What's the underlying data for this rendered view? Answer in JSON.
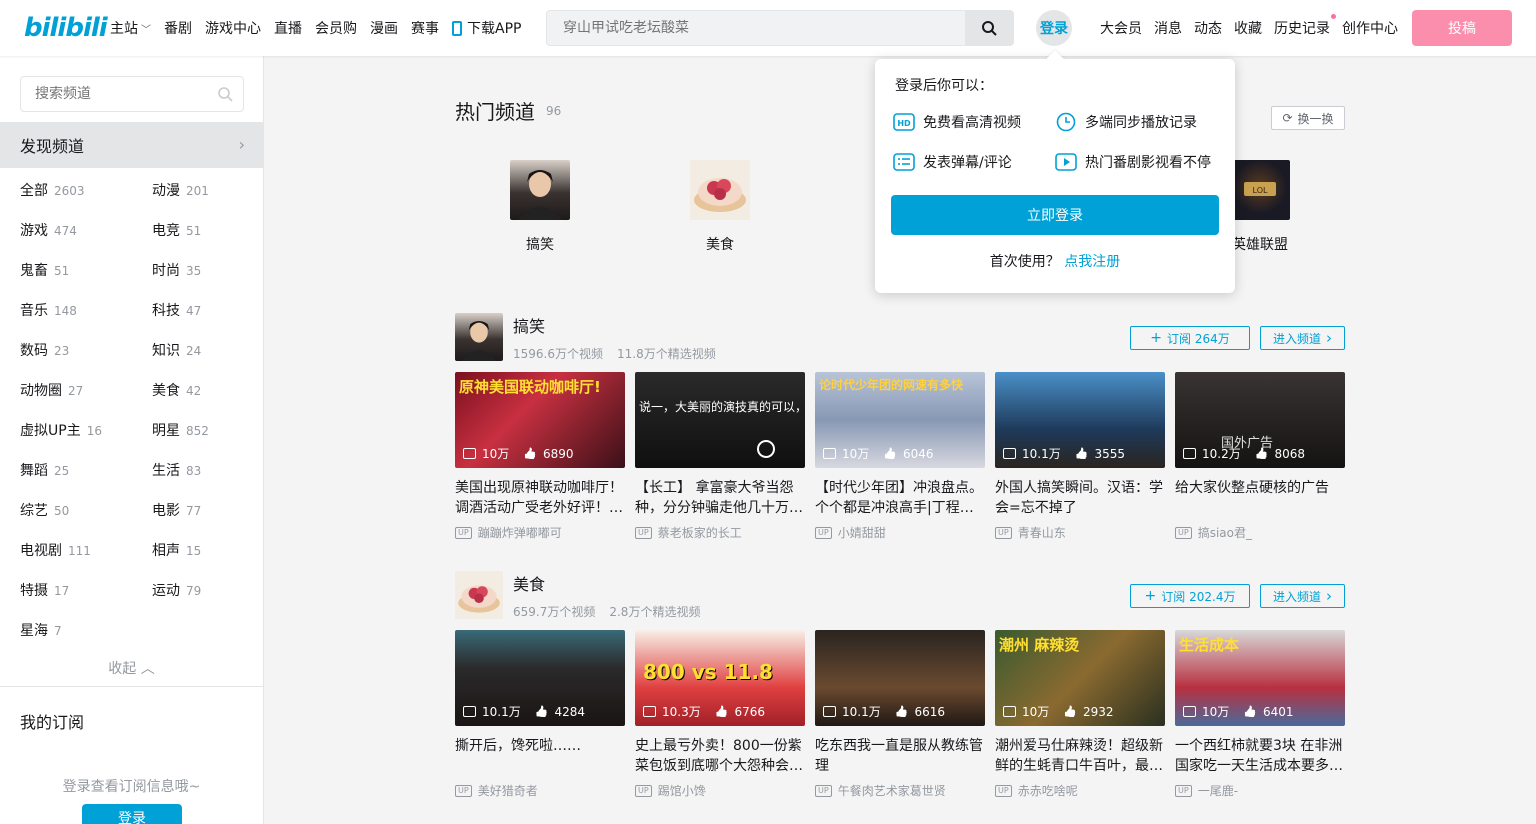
{
  "header": {
    "logo": "bilibili",
    "nav": [
      "主站",
      "番剧",
      "游戏中心",
      "直播",
      "会员购",
      "漫画",
      "赛事",
      "下载APP"
    ],
    "search_placeholder": "穿山甲试吃老坛酸菜",
    "login": "登录",
    "right_nav": [
      "大会员",
      "消息",
      "动态",
      "收藏",
      "历史记录",
      "创作中心"
    ],
    "upload": "投稿"
  },
  "sidebar": {
    "search_placeholder": "搜索频道",
    "discover": "发现频道",
    "categories": [
      {
        "name": "全部",
        "count": "2603"
      },
      {
        "name": "动漫",
        "count": "201"
      },
      {
        "name": "游戏",
        "count": "474"
      },
      {
        "name": "电竞",
        "count": "51"
      },
      {
        "name": "鬼畜",
        "count": "51"
      },
      {
        "name": "时尚",
        "count": "35"
      },
      {
        "name": "音乐",
        "count": "148"
      },
      {
        "name": "科技",
        "count": "47"
      },
      {
        "name": "数码",
        "count": "23"
      },
      {
        "name": "知识",
        "count": "24"
      },
      {
        "name": "动物圈",
        "count": "27"
      },
      {
        "name": "美食",
        "count": "42"
      },
      {
        "name": "虚拟UP主",
        "count": "16"
      },
      {
        "name": "明星",
        "count": "852"
      },
      {
        "name": "舞蹈",
        "count": "25"
      },
      {
        "name": "生活",
        "count": "83"
      },
      {
        "name": "综艺",
        "count": "50"
      },
      {
        "name": "电影",
        "count": "77"
      },
      {
        "name": "电视剧",
        "count": "111"
      },
      {
        "name": "相声",
        "count": "15"
      },
      {
        "name": "特摄",
        "count": "17"
      },
      {
        "name": "运动",
        "count": "79"
      },
      {
        "name": "星海",
        "count": "7"
      }
    ],
    "collapse": "收起",
    "my_subs": "我的订阅",
    "sub_hint": "登录查看订阅信息哦~",
    "login_btn": "登录"
  },
  "hot": {
    "title": "热门频道",
    "count": "96",
    "refresh": "换一换",
    "channels": [
      "搞笑",
      "美食",
      "英雄联盟"
    ]
  },
  "popup": {
    "heading": "登录后你可以：",
    "perks": [
      "免费看高清视频",
      "多端同步播放记录",
      "发表弹幕/评论",
      "热门番剧影视看不停"
    ],
    "login_btn": "立即登录",
    "first_time": "首次使用？",
    "register": "点我注册"
  },
  "sections": [
    {
      "name": "搞笑",
      "videos_count": "1596.6万个视频",
      "featured": "11.8万个精选视频",
      "subscribe": "订阅 264万",
      "enter": "进入频道",
      "cards": [
        {
          "plays": "10万",
          "likes": "6890",
          "title": "美国出现原神联动咖啡厅！调酒活动广受老外好评！…",
          "up": "蹦蹦炸弹嘟嘟可",
          "cover_text": "原神美国联动咖啡厅!"
        },
        {
          "plays": "",
          "likes": "",
          "title": "【长工】 拿富豪大爷当怨种，分分钟骗走他几十万…",
          "up": "蔡老板家的长工",
          "cover_text": "说一，大美丽的演技真的可以，"
        },
        {
          "plays": "10万",
          "likes": "6046",
          "title": "【时代少年团】冲浪盘点。个个都是冲浪高手|丁程…",
          "up": "小婧甜甜",
          "cover_text": "论时代少年团的网速有多快"
        },
        {
          "plays": "10.1万",
          "likes": "3555",
          "title": "外国人搞笑瞬间。汉语：学会=忘不掉了",
          "up": "青春山东",
          "cover_text": ""
        },
        {
          "plays": "10.2万",
          "likes": "8068",
          "title": "给大家伙整点硬核的广告",
          "up": "搞siao君_",
          "cover_text": "国外广告"
        }
      ]
    },
    {
      "name": "美食",
      "videos_count": "659.7万个视频",
      "featured": "2.8万个精选视频",
      "subscribe": "订阅 202.4万",
      "enter": "进入频道",
      "cards": [
        {
          "plays": "10.1万",
          "likes": "4284",
          "title": "撕开后，馋死啦……",
          "up": "美好猎奇者",
          "cover_text": ""
        },
        {
          "plays": "10.3万",
          "likes": "6766",
          "title": "史上最亏外卖！800一份紫菜包饭到底哪个大怨种会…",
          "up": "踢馆小馋",
          "cover_text": "800 vs 11.8"
        },
        {
          "plays": "10.1万",
          "likes": "6616",
          "title": "吃东西我一直是服从教练管理",
          "up": "午餐肉艺术家葛世贤",
          "cover_text": ""
        },
        {
          "plays": "10万",
          "likes": "2932",
          "title": "潮州爱马仕麻辣烫！超级新鲜的生蚝青口牛百叶，最…",
          "up": "赤赤吃啥呢",
          "cover_text": "潮州 麻辣烫"
        },
        {
          "plays": "10万",
          "likes": "6401",
          "title": "一个西红柿就要3块 在非洲国家吃一天生活成本要多…",
          "up": "一尾鹿-",
          "cover_text": "生活成本"
        }
      ]
    }
  ],
  "colors": {
    "accent": "#00a1d6",
    "pink": "#fb7299"
  }
}
